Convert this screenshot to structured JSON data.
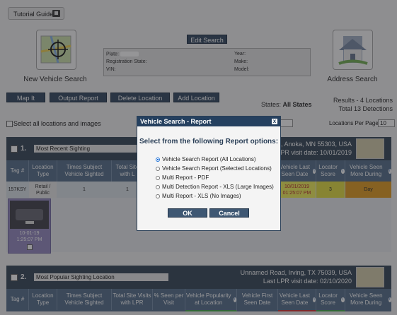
{
  "toolbar": {
    "tutorial_label": "Tutorial Guide"
  },
  "tiles": {
    "new_search": "New Vehicle Search",
    "address_search": "Address Search"
  },
  "edit_search_label": "Edit Search",
  "search_fields": {
    "plate": "Plate:",
    "registration_state": "Registration State:",
    "vin": "VIN:",
    "year": "Year:",
    "make": "Make:",
    "model": "Model:"
  },
  "actions": {
    "map_it": "Map It",
    "output_report": "Output Report",
    "delete_location": "Delete Location",
    "add_location": "Add Location"
  },
  "states": {
    "label": "States:",
    "value": "All States"
  },
  "results": {
    "locations": "Results - 4 Locations",
    "detections": "Total 13 Detections"
  },
  "select_all_label": "Select all locations and images",
  "per_page": {
    "label": "Locations Per Page",
    "value": "10"
  },
  "sections": [
    {
      "number": "1.",
      "title": "Most Recent Sighting",
      "address": "lvd, Anoka, MN 55303, USA",
      "last_visit": "t LPR visit date: 10/01/2019",
      "row": {
        "tag": "157KSY",
        "location_type": "Retail / Public",
        "times_sighted": "1",
        "total_sites": "1",
        "last_seen": "10/01/2019 01:25:07 PM",
        "locator_score": "3",
        "seen_during": "Day"
      },
      "thumb_caption_date": "10-01-19",
      "thumb_caption_time": "1:25:07 PM"
    },
    {
      "number": "2.",
      "title": "Most Popular Sighting Location",
      "address": "Unnamed Road, Irving, TX 75039, USA",
      "last_visit": "Last LPR visit date: 02/10/2020"
    }
  ],
  "columns_partial": {
    "tag": "Tag #",
    "location_type": "Location Type",
    "times_sighted": "Times Subject Vehicle Sighted",
    "total_sites": "Total Site with L",
    "last_seen": "Vehicle Last Seen Date",
    "locator_score": "Locator Score",
    "seen_during": "Vehicle Seen More During"
  },
  "columns_full": {
    "tag": "Tag #",
    "location_type": "Location Type",
    "times_sighted": "Times Subject Vehicle Sighted",
    "total_sites": "Total Site Visits with LPR",
    "pct_seen": "% Seen per Visit",
    "popularity": "Vehicle Popularity at Location",
    "first_seen": "Vehicle First Seen Date",
    "last_seen": "Vehicle Last Seen Date",
    "locator_score": "Locator Score",
    "seen_during": "Vehicle Seen More During"
  },
  "modal": {
    "title": "Vehicle Search - Report",
    "close": "x",
    "heading": "Select from the following Report options:",
    "options": [
      "Vehicle Search Report (All Locations)",
      "Vehicle Search Report (Selected Locations)",
      "Multi Report - PDF",
      "Multi Detection Report - XLS (Large Images)",
      "Multi Report - XLS (No Images)"
    ],
    "selected_index": 0,
    "ok": "OK",
    "cancel": "Cancel"
  },
  "colors": {
    "header_bg": "#3f4f60",
    "table_header": "#5d7590",
    "highlight_yellow": "#f3f061",
    "score_yellow": "#e6e04a",
    "day_orange": "#e3a12b",
    "modal_title": "#25405f"
  },
  "icons": [
    "tutorial-icon",
    "map-crosshair-icon",
    "house-icon",
    "info-icon",
    "close-icon",
    "map-thumbnail-icon"
  ]
}
